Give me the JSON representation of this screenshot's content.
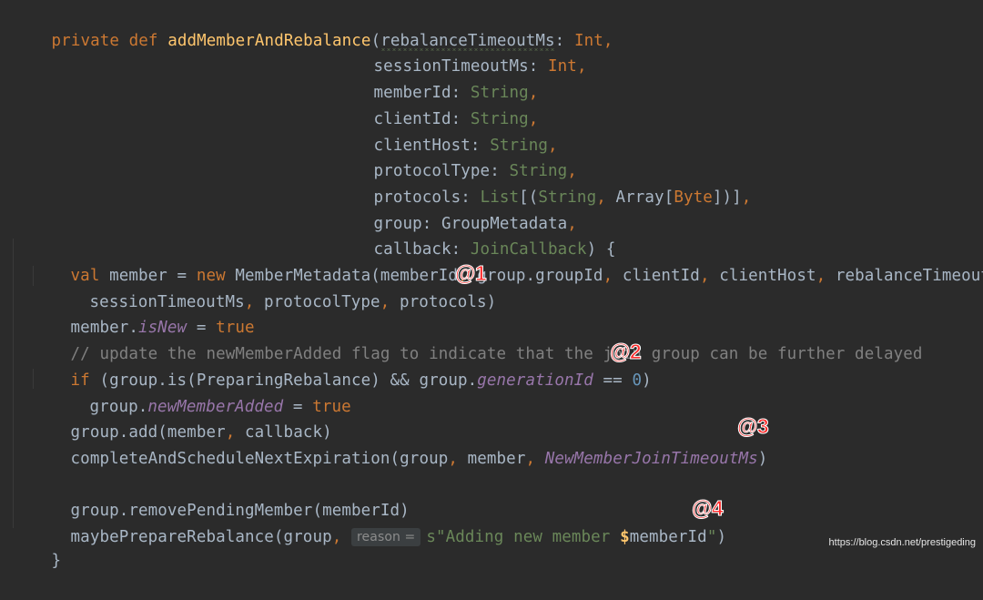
{
  "code": {
    "l1": {
      "kw1": "private",
      "kw2": "def",
      "fn": "addMemberAndRebalance",
      "p1": "(",
      "param": "rebalanceTimeoutMs",
      "colon": ": ",
      "type": "Int",
      "comma": ","
    },
    "l2": {
      "param": "sessionTimeoutMs",
      "colon": ": ",
      "type": "Int",
      "comma": ","
    },
    "l3": {
      "param": "memberId",
      "colon": ": ",
      "type": "String",
      "comma": ","
    },
    "l4": {
      "param": "clientId",
      "colon": ": ",
      "type": "String",
      "comma": ","
    },
    "l5": {
      "param": "clientHost",
      "colon": ": ",
      "type": "String",
      "comma": ","
    },
    "l6": {
      "param": "protocolType",
      "colon": ": ",
      "type": "String",
      "comma": ","
    },
    "l7": {
      "param": "protocols",
      "colon": ": ",
      "type1": "List",
      "br1": "[(",
      "type2": "String",
      "c1": ", ",
      "type3": "Array",
      "br2": "[",
      "type4": "Byte",
      "br3": "])]",
      "comma": ","
    },
    "l8": {
      "param": "group",
      "colon": ": ",
      "type": "GroupMetadata",
      "comma": ","
    },
    "l9": {
      "param": "callback",
      "colon": ": ",
      "type": "JoinCallback",
      "end": ") {"
    },
    "l10": {
      "kw": "val",
      "t1": " member = ",
      "kw2": "new",
      "t2": " MemberMetadata(memberId",
      "c1": ", ",
      "t3": "group.groupId",
      "c2": ", ",
      "t4": "clientId",
      "c3": ", ",
      "t5": "clientHost",
      "c4": ", ",
      "t6": "rebalanceTimeoutMs",
      "c5": ","
    },
    "l11": {
      "t1": "sessionTimeoutMs",
      "c1": ", ",
      "t2": "protocolType",
      "c2": ", ",
      "t3": "protocols)"
    },
    "l12": {
      "t1": "member.",
      "prop": "isNew",
      "t2": " = ",
      "kw": "true"
    },
    "l13": {
      "comment": "// update the newMemberAdded flag to indicate that the join group can be further delayed"
    },
    "l14": {
      "kw": "if",
      "t1": " (group.is(PreparingRebalance) && group.",
      "prop": "generationId",
      "t2": " == ",
      "num": "0",
      "t3": ")"
    },
    "l15": {
      "t1": "group.",
      "prop": "newMemberAdded",
      "t2": " = ",
      "kw": "true"
    },
    "l16": {
      "t1": "group.add(member",
      "c1": ", ",
      "t2": "callback)"
    },
    "l17": {
      "t1": "completeAndScheduleNextExpiration(group",
      "c1": ", ",
      "t2": "member",
      "c2": ", ",
      "prop": "NewMemberJoinTimeoutMs",
      "t3": ")"
    },
    "l19": {
      "t1": "group.removePendingMember(memberId)"
    },
    "l20": {
      "t1": "maybePrepareRebalance(group",
      "c1": ", ",
      "hint": "reason =",
      "s1": "s\"Adding new member ",
      "sv": "$",
      "t2": "memberId",
      "s2": "\"",
      "t3": ")"
    },
    "l21": {
      "t1": "}"
    }
  },
  "callouts": {
    "c1": "@1",
    "c2": "@2",
    "c3": "@3",
    "c4": "@4"
  },
  "watermark": "https://blog.csdn.net/prestigeding",
  "colors": {
    "background": "#2b2b2b",
    "keyword": "#cc7832",
    "function": "#ffc66d",
    "type_string": "#6a8759",
    "default": "#a9b7c6",
    "property": "#9876aa",
    "comment": "#808080",
    "number": "#6897bb",
    "callout": "#ff2a2a"
  }
}
